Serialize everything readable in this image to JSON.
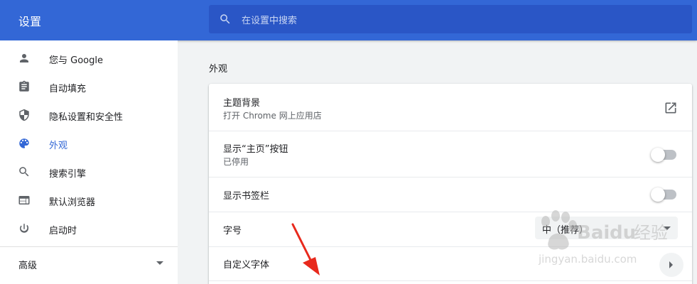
{
  "app": {
    "title": "设置"
  },
  "search": {
    "placeholder": "在设置中搜索"
  },
  "sidebar": {
    "items": [
      {
        "label": "您与 Google",
        "icon": "person-icon"
      },
      {
        "label": "自动填充",
        "icon": "clipboard-icon"
      },
      {
        "label": "隐私设置和安全性",
        "icon": "shield-icon"
      },
      {
        "label": "外观",
        "icon": "palette-icon",
        "active": true
      },
      {
        "label": "搜索引擎",
        "icon": "search-icon"
      },
      {
        "label": "默认浏览器",
        "icon": "browser-window-icon"
      },
      {
        "label": "启动时",
        "icon": "power-icon"
      }
    ],
    "advanced_label": "高级"
  },
  "main": {
    "section_title": "外观",
    "rows": [
      {
        "title": "主题背景",
        "subtitle": "打开 Chrome 网上应用店",
        "control": "external-link"
      },
      {
        "title": "显示“主页”按钮",
        "subtitle": "已停用",
        "control": "toggle",
        "checked": false
      },
      {
        "title": "显示书签栏",
        "control": "toggle",
        "checked": false
      },
      {
        "title": "字号",
        "control": "select",
        "value": "中（推荐）"
      },
      {
        "title": "自定义字体",
        "control": "arrow"
      }
    ]
  },
  "watermark": {
    "brand": "Baidu经验",
    "url": "jingyan.baidu.com"
  },
  "colors": {
    "header": "#3367d6",
    "search": "#2a56c6",
    "accent": "#3367d6",
    "annotation": "#e8291c"
  }
}
